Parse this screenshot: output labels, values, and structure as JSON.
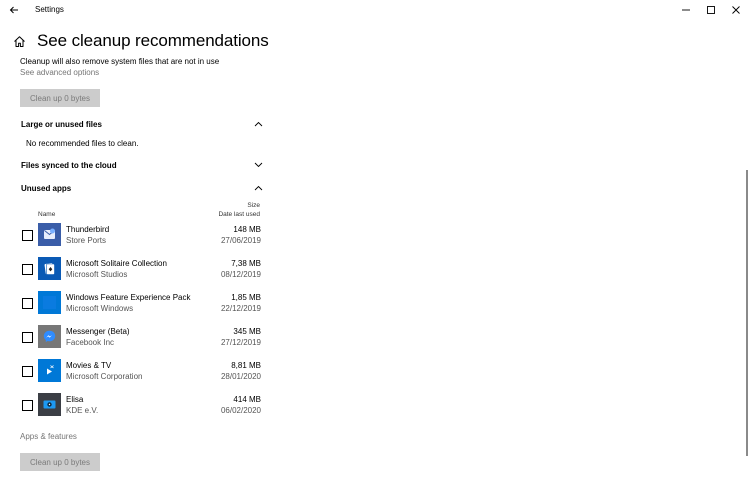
{
  "window": {
    "title": "Settings"
  },
  "page": {
    "title": "See cleanup recommendations",
    "description": "Cleanup will also remove system files that are not in use",
    "advanced_link": "See advanced options",
    "cleanup_button_top": "Clean up 0 bytes",
    "cleanup_button_bottom": "Clean up 0 bytes",
    "apps_features_link": "Apps & features"
  },
  "sections": {
    "large_files": {
      "label": "Large or unused files",
      "state": "expanded",
      "empty_text": "No recommended files to clean."
    },
    "cloud_files": {
      "label": "Files synced to the cloud",
      "state": "collapsed"
    },
    "unused_apps": {
      "label": "Unused apps",
      "state": "expanded"
    }
  },
  "apps_table": {
    "headers": {
      "name": "Name",
      "size": "Size",
      "date": "Date last used"
    },
    "rows": [
      {
        "name": "Thunderbird",
        "publisher": "Store Ports",
        "size": "148 MB",
        "date": "27/06/2019",
        "icon": "thunderbird-icon",
        "icon_color": "#3a5da8"
      },
      {
        "name": "Microsoft Solitaire Collection",
        "publisher": "Microsoft Studios",
        "size": "7,38 MB",
        "date": "08/12/2019",
        "icon": "solitaire-icon",
        "icon_color": "#0a5ab5"
      },
      {
        "name": "Windows Feature Experience Pack",
        "publisher": "Microsoft Windows",
        "size": "1,85 MB",
        "date": "22/12/2019",
        "icon": "feature-pack-icon",
        "icon_color": "#0078d7"
      },
      {
        "name": "Messenger (Beta)",
        "publisher": "Facebook Inc",
        "size": "345 MB",
        "date": "27/12/2019",
        "icon": "messenger-icon",
        "icon_color": "#777777"
      },
      {
        "name": "Movies & TV",
        "publisher": "Microsoft Corporation",
        "size": "8,81 MB",
        "date": "28/01/2020",
        "icon": "movies-tv-icon",
        "icon_color": "#0078d7"
      },
      {
        "name": "Elisa",
        "publisher": "KDE e.V.",
        "size": "414 MB",
        "date": "06/02/2020",
        "icon": "elisa-icon",
        "icon_color": "#3b3e45"
      }
    ]
  }
}
